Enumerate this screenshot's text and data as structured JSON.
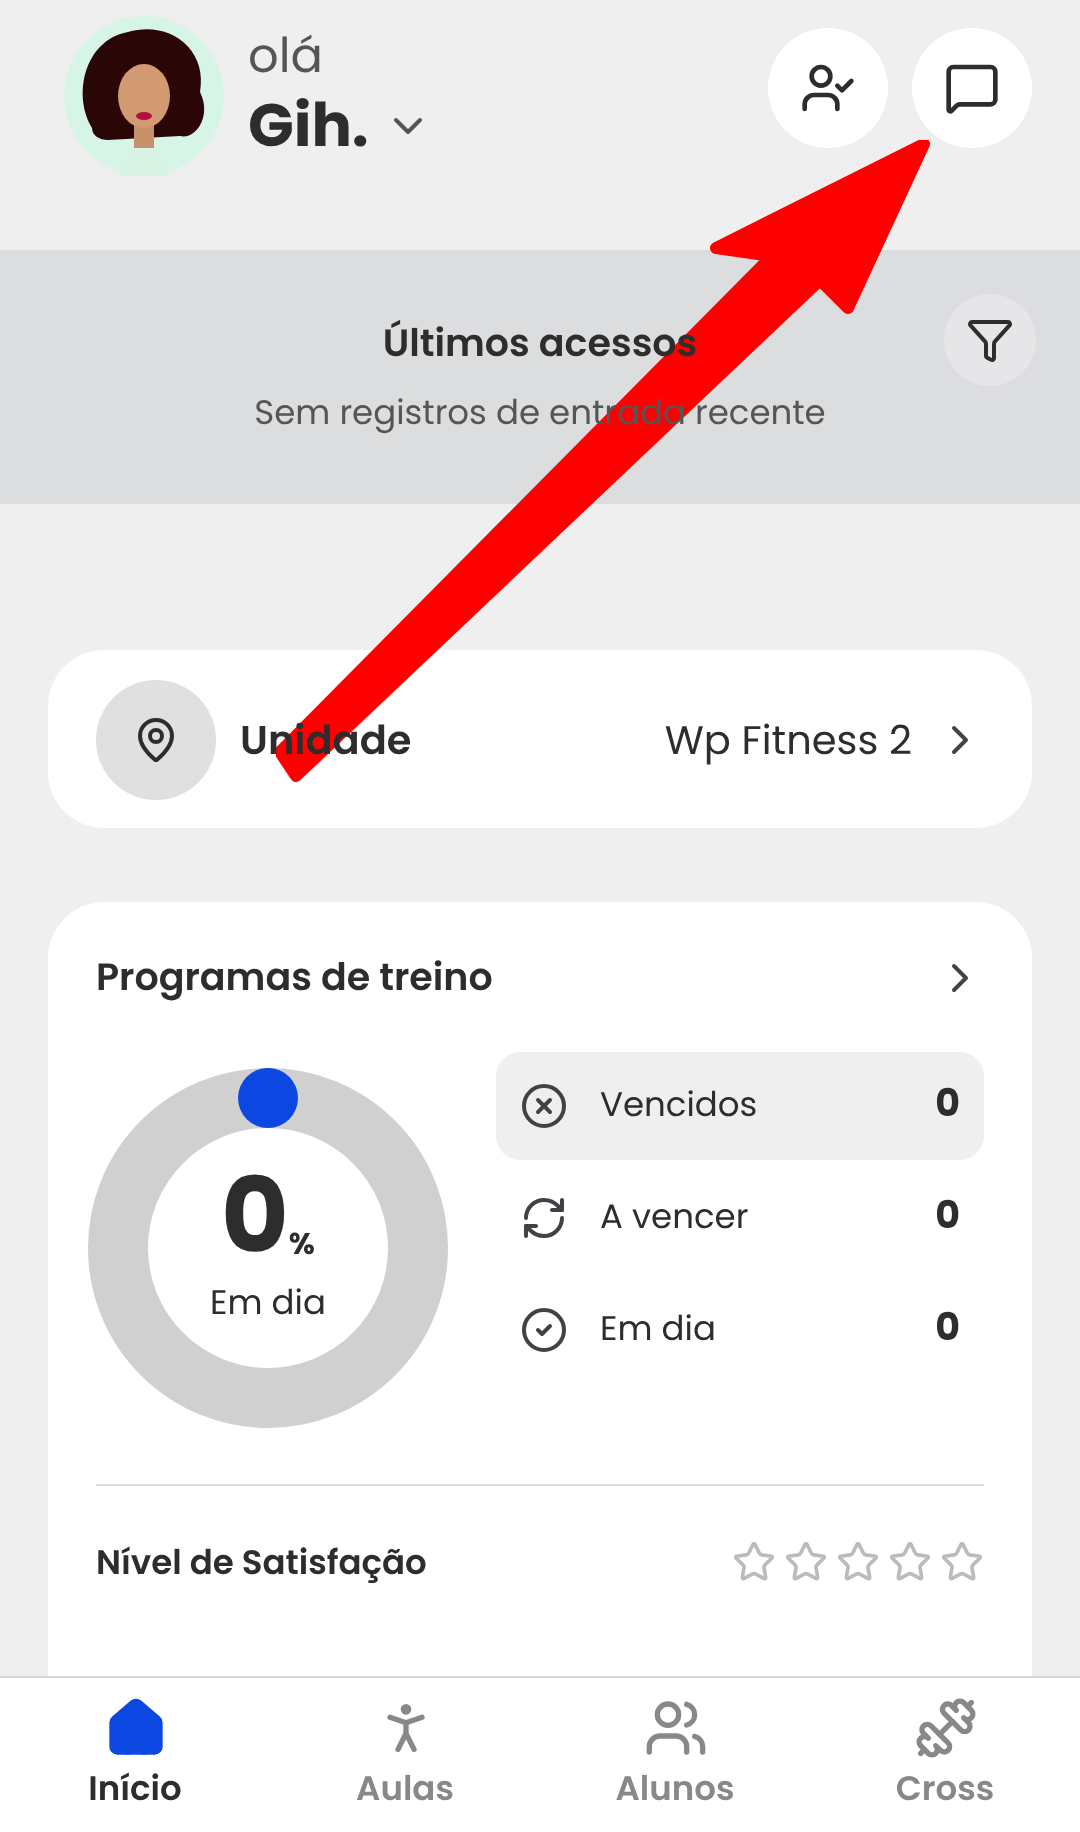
{
  "header": {
    "greeting": "olá",
    "user_name": "Gih."
  },
  "recent_access": {
    "title": "Últimos acessos",
    "message": "Sem registros de entrada recente"
  },
  "unit": {
    "label": "Unidade",
    "value": "Wp Fitness 2"
  },
  "programs": {
    "title": "Programas de treino",
    "progress": {
      "level": 0,
      "value": "0",
      "unit": "%",
      "caption": "Em dia"
    },
    "statuses": [
      {
        "kind": "expired",
        "label": "Vencidos",
        "count": "0",
        "selected": true
      },
      {
        "kind": "expiring",
        "label": "A vencer",
        "count": "0",
        "selected": false
      },
      {
        "kind": "ok",
        "label": "Em dia",
        "count": "0",
        "selected": false
      }
    ],
    "satisfaction": {
      "label": "Nível de Satisfação",
      "stars": 0
    }
  },
  "nav": [
    {
      "kind": "home",
      "label": "Início",
      "selected": true
    },
    {
      "kind": "classes",
      "label": "Aulas",
      "selected": false
    },
    {
      "kind": "students",
      "label": "Alunos",
      "selected": false
    },
    {
      "kind": "cross",
      "label": "Cross",
      "selected": false
    }
  ]
}
